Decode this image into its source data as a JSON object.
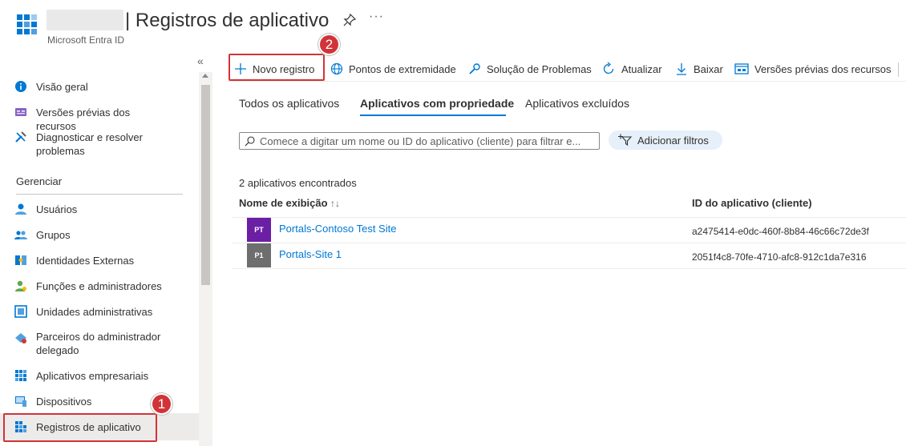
{
  "header": {
    "title": "| Registros de aplicativo",
    "subtitle": "Microsoft Entra ID",
    "more_label": "···"
  },
  "sidebar": {
    "collapse_label": "«",
    "section_manage": "Gerenciar",
    "items": [
      {
        "label": "Visão geral",
        "icon": "info-icon"
      },
      {
        "label": "Versões prévias dos recursos",
        "icon": "preview-icon"
      },
      {
        "label": "Diagnosticar e resolver problemas",
        "icon": "wrench-icon"
      },
      {
        "label": "Usuários",
        "icon": "user-icon"
      },
      {
        "label": "Grupos",
        "icon": "group-icon"
      },
      {
        "label": "Identidades Externas",
        "icon": "external-identities-icon"
      },
      {
        "label": "Funções e administradores",
        "icon": "roles-icon"
      },
      {
        "label": "Unidades administrativas",
        "icon": "admin-units-icon"
      },
      {
        "label": "Parceiros do administrador delegado",
        "icon": "partners-icon"
      },
      {
        "label": "Aplicativos empresariais",
        "icon": "enterprise-apps-icon"
      },
      {
        "label": "Dispositivos",
        "icon": "devices-icon"
      },
      {
        "label": "Registros de aplicativo",
        "icon": "app-registrations-icon"
      }
    ]
  },
  "toolbar": {
    "new_registration": "Novo registro",
    "endpoints": "Pontos de extremidade",
    "troubleshooting": "Solução de Problemas",
    "refresh": "Atualizar",
    "download": "Baixar",
    "preview_features": "Versões prévias dos recursos"
  },
  "tabs": [
    {
      "label": "Todos os aplicativos"
    },
    {
      "label": "Aplicativos com propriedade"
    },
    {
      "label": "Aplicativos excluídos"
    }
  ],
  "search": {
    "placeholder": "Comece a digitar um nome ou ID do aplicativo (cliente) para filtrar e..."
  },
  "filter_button": "Adicionar filtros",
  "results_count": "2 aplicativos encontrados",
  "table": {
    "headers": [
      "Nome de exibição",
      "ID do aplicativo (cliente)"
    ],
    "sort_glyph": "↑↓",
    "rows": [
      {
        "initials": "PT",
        "name": "Portals-Contoso Test Site",
        "app_id": "a2475414-e0dc-460f-8b84-46c66c72de3f",
        "color": "#6b1fa5"
      },
      {
        "initials": "P1",
        "name": "Portals-Site 1",
        "app_id": "2051f4c8-70fe-4710-afc8-912c1da7e316",
        "color": "#6e6e6e"
      }
    ]
  },
  "callouts": [
    {
      "number": "1"
    },
    {
      "number": "2"
    }
  ],
  "colors": {
    "accent": "#0078d4",
    "callout": "#d13438"
  }
}
